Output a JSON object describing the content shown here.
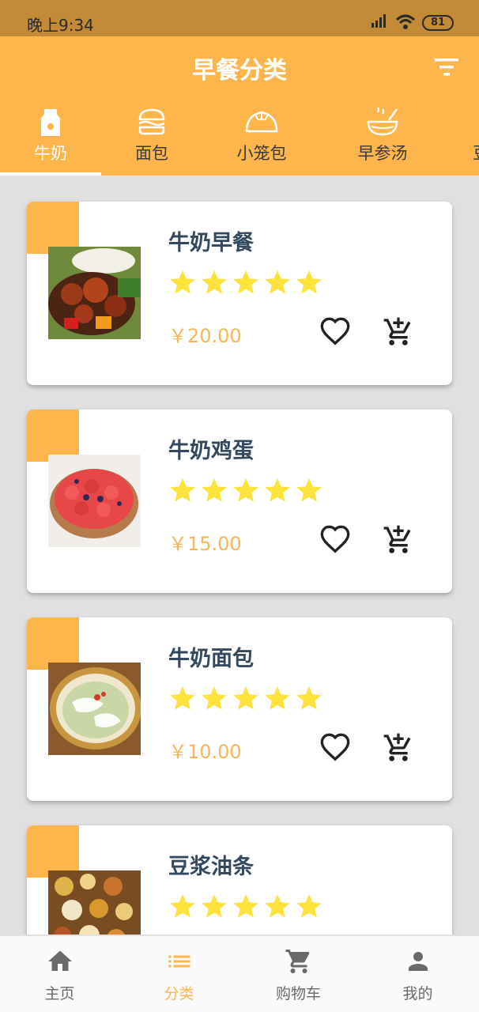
{
  "status_bar": {
    "time": "晚上9:34",
    "battery": "81"
  },
  "header": {
    "title": "早餐分类"
  },
  "tabs": [
    {
      "label": "牛奶",
      "icon": "milk-icon",
      "active": true
    },
    {
      "label": "面包",
      "icon": "burger-icon",
      "active": false
    },
    {
      "label": "小笼包",
      "icon": "bun-icon",
      "active": false
    },
    {
      "label": "早参汤",
      "icon": "soup-bowl-icon",
      "active": false
    },
    {
      "label": "豆",
      "icon": "partial-tab-icon",
      "active": false
    }
  ],
  "items": [
    {
      "name": "牛奶早餐",
      "price": "￥20.00",
      "rating": 5,
      "photo": "braised-meat-dish"
    },
    {
      "name": "牛奶鸡蛋",
      "price": "￥15.00",
      "rating": 5,
      "photo": "strawberry-tart"
    },
    {
      "name": "牛奶面包",
      "price": "￥10.00",
      "rating": 5,
      "photo": "fish-soup"
    },
    {
      "name": "豆浆油条",
      "price": "",
      "rating": 5,
      "photo": "breakfast-spread"
    }
  ],
  "bottom_nav": [
    {
      "label": "主页",
      "icon": "home-icon",
      "active": false
    },
    {
      "label": "分类",
      "icon": "list-icon",
      "active": true
    },
    {
      "label": "购物车",
      "icon": "cart-icon",
      "active": false
    },
    {
      "label": "我的",
      "icon": "person-icon",
      "active": false
    }
  ],
  "colors": {
    "primary": "#feb64c",
    "status_bar": "#c38a38",
    "star": "#fde33b",
    "price": "#f6b659",
    "title_text": "#34495e"
  }
}
